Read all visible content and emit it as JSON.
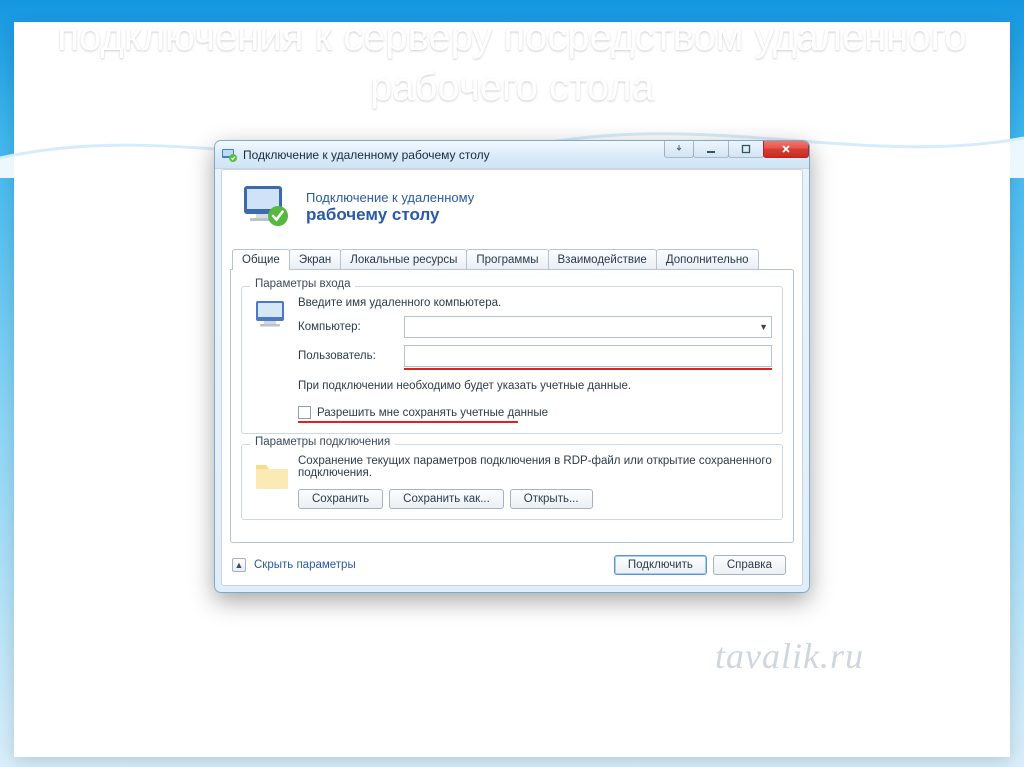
{
  "slide": {
    "title": "подключения к серверу посредством удаленного рабочего стола"
  },
  "window": {
    "title": "Подключение к удаленному рабочему столу",
    "header_line1": "Подключение к удаленному",
    "header_line2": "рабочему столу",
    "tabs": [
      "Общие",
      "Экран",
      "Локальные ресурсы",
      "Программы",
      "Взаимодействие",
      "Дополнительно"
    ],
    "active_tab": 0
  },
  "login": {
    "group_title": "Параметры входа",
    "instruction": "Введите имя удаленного компьютера.",
    "computer_label": "Компьютер:",
    "computer_value": "",
    "user_label": "Пользователь:",
    "user_value": "",
    "note": "При подключении необходимо будет указать учетные данные.",
    "remember_label": "Разрешить мне сохранять учетные данные"
  },
  "connparams": {
    "group_title": "Параметры подключения",
    "text": "Сохранение текущих параметров подключения в RDP-файл или открытие сохраненного подключения.",
    "save_label": "Сохранить",
    "save_as_label": "Сохранить как...",
    "open_label": "Открыть..."
  },
  "footer": {
    "hide_params": "Скрыть параметры",
    "connect": "Подключить",
    "help": "Справка"
  },
  "watermark": "tavalik.ru"
}
